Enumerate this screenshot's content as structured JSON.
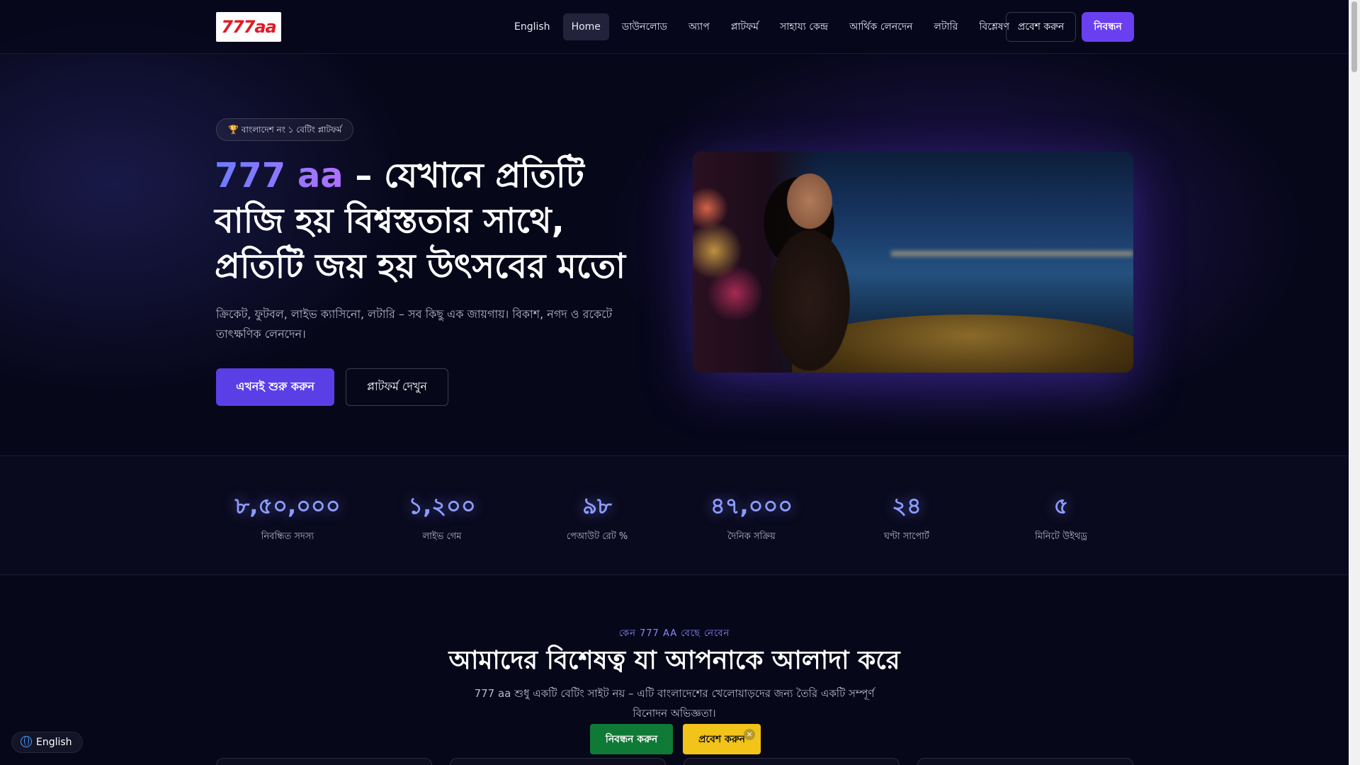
{
  "header": {
    "logo_text": "777aa",
    "nav": [
      {
        "label": "English"
      },
      {
        "label": "Home",
        "active": true
      },
      {
        "label": "ডাউনলোড"
      },
      {
        "label": "অ্যাপ"
      },
      {
        "label": "প্লাটফর্ম"
      },
      {
        "label": "সাহায্য কেন্দ্র"
      },
      {
        "label": "আর্থিক লেনদেন"
      },
      {
        "label": "লটারি"
      },
      {
        "label": "বিশ্লেষণ"
      }
    ],
    "login_label": "প্রবেশ করুন",
    "register_label": "নিবন্ধন"
  },
  "hero": {
    "badge": "🏆 বাংলাদেশ নং ১ বেটিং প্লাটফর্ম",
    "title_brand": "777 aa",
    "title_rest": " – যেখানে প্রতিটি বাজি হয় বিশ্বস্ততার সাথে, প্রতিটি জয় হয় উৎসবের মতো",
    "subtitle": "ক্রিকেট, ফুটবল, লাইভ ক্যাসিনো, লটারি – সব কিছু এক জায়গায়। বিকাশ, নগদ ও রকেটে তাৎক্ষণিক লেনদেন।",
    "start_label": "এখনই শুরু করুন",
    "platform_label": "প্লাটফর্ম দেখুন"
  },
  "stats": [
    {
      "value": "৮,৫০,০০০",
      "label": "নিবন্ধিত সদস্য"
    },
    {
      "value": "১,২০০",
      "label": "লাইভ গেম"
    },
    {
      "value": "৯৮",
      "label": "পেআউট রেট %"
    },
    {
      "value": "৪৭,০০০",
      "label": "দৈনিক সক্রিয়"
    },
    {
      "value": "২৪",
      "label": "ঘণ্টা সাপোর্ট"
    },
    {
      "value": "৫",
      "label": "মিনিটে উইথড্র"
    }
  ],
  "why": {
    "tag": "কেন 777 AA বেছে নেবেন",
    "title": "আমাদের বিশেষত্ব যা আপনাকে আলাদা করে",
    "desc": "777 aa শুধু একটি বেটিং সাইট নয় – এটি বাংলাদেশের খেলোয়াড়দের জন্য তৈরি একটি সম্পূর্ণ বিনোদন অভিজ্ঞতা।"
  },
  "floating": {
    "language": "English",
    "register_label": "নিবন্ধন করুন",
    "login_label": "প্রবেশ করুন",
    "close_glyph": "×"
  },
  "colors": {
    "accent": "#6a3ff0",
    "stat_value": "#8c9cff",
    "float_register": "#0f7a36",
    "float_login": "#f2c318"
  }
}
